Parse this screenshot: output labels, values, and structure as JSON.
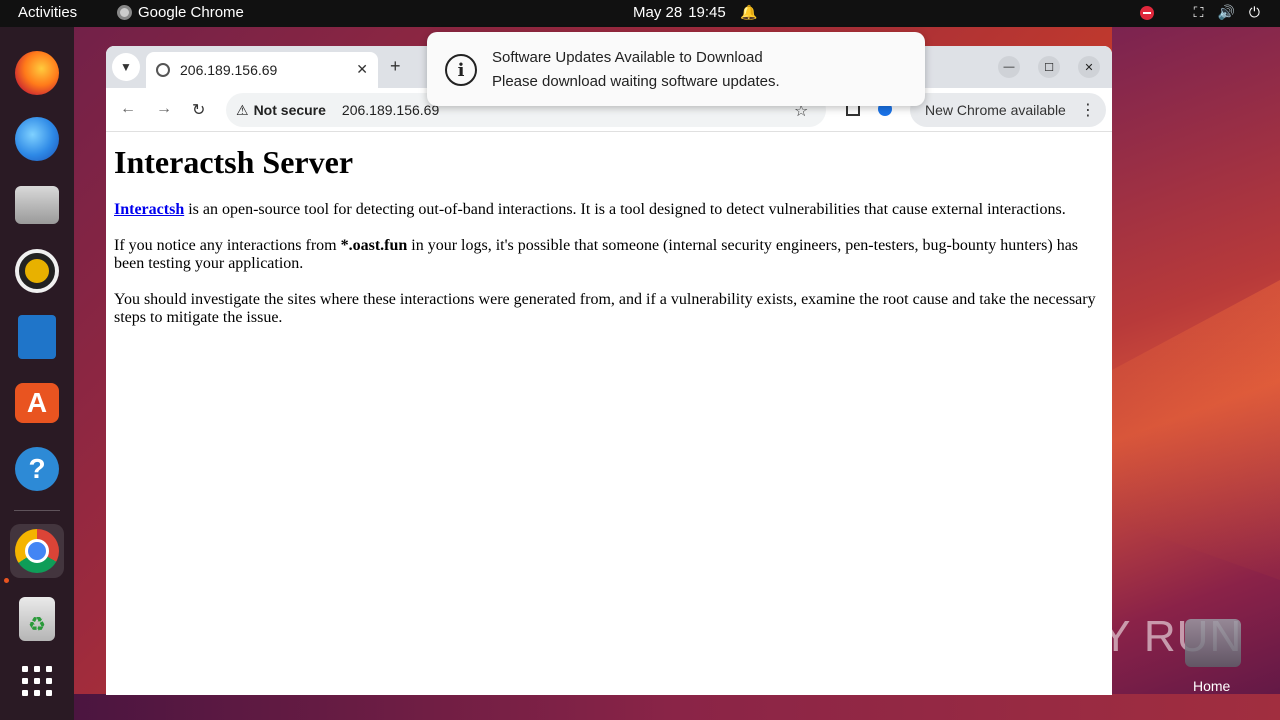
{
  "topbar": {
    "activities": "Activities",
    "app_name": "Google Chrome",
    "date": "May 28",
    "time": "19:45"
  },
  "dock": {
    "items": [
      "firefox-icon",
      "thunderbird-icon",
      "files-icon",
      "rhythmbox-icon",
      "libreoffice-writer-icon",
      "app-center-icon",
      "help-icon",
      "chrome-icon",
      "trash-icon",
      "show-apps-icon"
    ],
    "active": "chrome-icon"
  },
  "browser": {
    "tab_title": "206.189.156.69",
    "omnibox": {
      "security_label": "Not secure",
      "url": "206.189.156.69"
    },
    "update_button": "New Chrome available"
  },
  "page": {
    "heading": "Interactsh Server",
    "p1_link": "Interactsh",
    "p1_text": " is an open-source tool for detecting out-of-band interactions. It is a tool designed to detect vulnerabilities that cause external interactions.",
    "p2_before": "If you notice any interactions from ",
    "p2_bold": "*.oast.fun",
    "p2_after": " in your logs, it's possible that someone (internal security engineers, pen-testers, bug-bounty hunters) has been testing your application.",
    "p3": "You should investigate the sites where these interactions were generated from, and if a vulnerability exists, examine the root cause and take the necessary steps to mitigate the issue."
  },
  "notification": {
    "title": "Software Updates Available to Download",
    "body": "Please download waiting software updates."
  },
  "desktop": {
    "watermark": "ANY RUN",
    "home_label": "Home"
  },
  "colors": {
    "accent": "#e95420",
    "link": "#0000ee"
  }
}
